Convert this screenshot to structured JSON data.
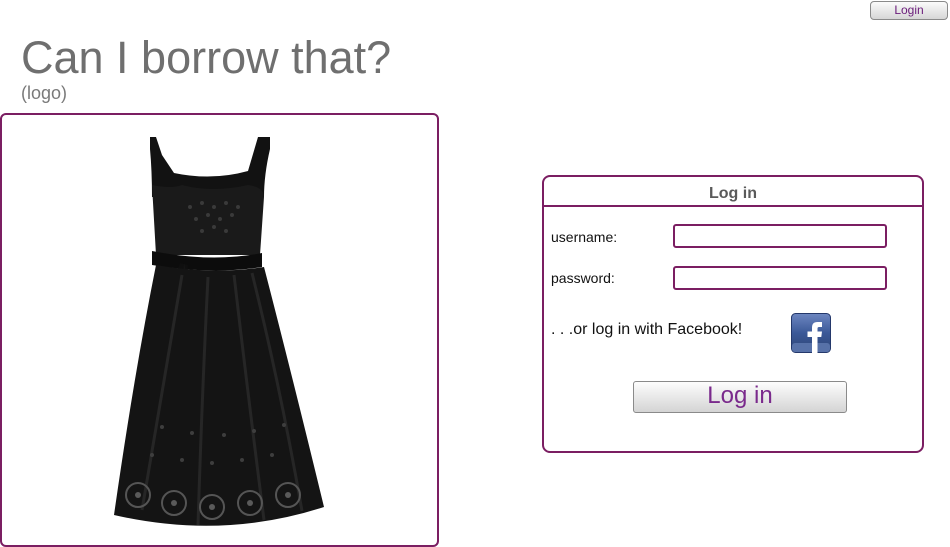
{
  "header": {
    "login_button_label": "Login",
    "site_title": "Can I borrow that?",
    "logo_placeholder": "(logo)"
  },
  "colors": {
    "accent": "#7b1e62",
    "button_text": "#7a2a8c",
    "title_text": "#6f6f6f"
  },
  "product_image": {
    "icon": "black-dress-image"
  },
  "login_panel": {
    "title": "Log in",
    "username_label": "username:",
    "username_value": "",
    "password_label": "password:",
    "password_value": "",
    "facebook_text": ". . .or log in with Facebook!",
    "facebook_icon": "facebook-icon",
    "submit_label": "Log in"
  }
}
